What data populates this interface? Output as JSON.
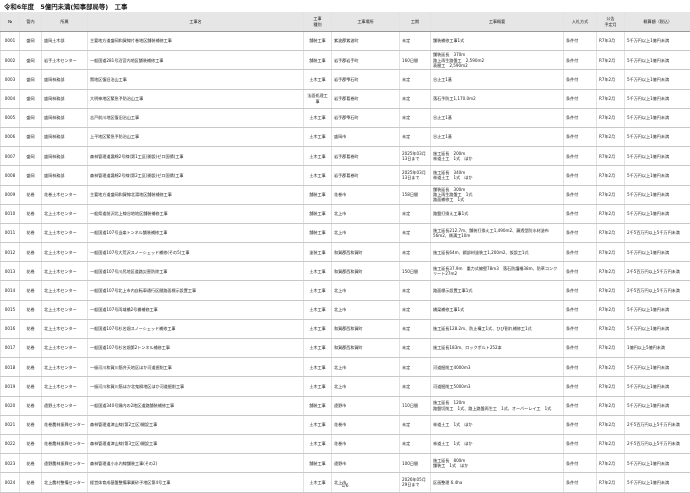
{
  "title": "令和6年度　5億円未満(知事部局等)　工事",
  "page_number": "1/6",
  "columns": [
    "№",
    "管内",
    "所属",
    "工事名",
    "工事\n種別",
    "工事場所",
    "工期",
    "工事概要",
    "入札方式",
    "公告\n予定月",
    "概算額（税込）"
  ],
  "rows": [
    [
      "0001",
      "盛岡",
      "盛岡土木部",
      "主要地方道盛岡和賀線片巻地区舗装補修工事",
      "舗装工事",
      "紫波郡紫波町",
      "未定",
      "舗装補修工事1式",
      "条件付",
      "R7年3月",
      "5千万円以上1億円未満"
    ],
    [
      "0002",
      "盛岡",
      "岩手土木センター",
      "一般国道281号沼宮内地区舗装補修工事",
      "舗装工事",
      "岩手郡岩手町",
      "160日間",
      "舗装延長　370m\n路上再生路盤工　2,590m2\n表層工　2,590m2",
      "条件付",
      "R7年2月",
      "5千万円以上1億円未満"
    ],
    [
      "0003",
      "盛岡",
      "盛岡林務部",
      "賢地区復旧治山工事",
      "土木工事",
      "岩手郡雫石町",
      "未定",
      "谷止工1基",
      "条件付",
      "R7年2月",
      "5千万円以上1億円未満"
    ],
    [
      "0004",
      "盛岡",
      "盛岡林務部",
      "大明神地区緊急予防治山工事",
      "法面処理工事",
      "岩手郡葛巻町",
      "未定",
      "落石予防工1,170.0m2",
      "条件付",
      "R7年2月",
      "5千万円以上1億円未満"
    ],
    [
      "0005",
      "盛岡",
      "盛岡林務部",
      "志戸前川地区復旧治山工事",
      "土木工事",
      "岩手郡雫石町",
      "未定",
      "谷止工1基",
      "条件付",
      "R7年2月",
      "5千万円以上1億円未満"
    ],
    [
      "0006",
      "盛岡",
      "盛岡林務部",
      "上平地区緊急予防治山工事",
      "土木工事",
      "盛岡市",
      "未定",
      "谷止工1基",
      "条件付",
      "R7年2月",
      "5千万円以上1億円未満"
    ],
    [
      "0007",
      "盛岡",
      "盛岡林務部",
      "森林管理道袰綿2号線(第1工区)開設(ゼロ国債)工事",
      "土木工事",
      "岩手郡葛巻町",
      "2025年03月\n13日まで",
      "施工延長　200m\n林道土工　1式　ほか",
      "条件付",
      "R7年2月",
      "5千万円以上1億円未満"
    ],
    [
      "0008",
      "盛岡",
      "盛岡林務部",
      "森林管理道袰綿2号線(第2工区)開設(ゼロ国債)工事",
      "土木工事",
      "岩手郡葛巻町",
      "2025年03月\n13日まで",
      "施工延長　340m\n林道土工　1式　ほか",
      "条件付",
      "R7年2月",
      "5千万円以上1億円未満"
    ],
    [
      "0009",
      "花巻",
      "花巻土木センター",
      "主要地方道盛岡和賀線北湯地区舗装補修工事",
      "舗装工事",
      "花巻市",
      "158日間",
      "舗装延長　300m\n路上再生路盤工　1式\n路面補修工　1式",
      "条件付",
      "R7年2月",
      "5千万円以上1億円未満"
    ],
    [
      "0010",
      "花巻",
      "北上土木センター",
      "一般県道前沢北上線谷地地区舗装補修工事",
      "舗装工事",
      "北上市",
      "未定",
      "路盤打換え工事1式",
      "条件付",
      "R7年2月",
      "5千万円以上1億円未満"
    ],
    [
      "0011",
      "花巻",
      "北上土木センター",
      "一般国道107号当楽トンネル舗装補修工事",
      "舗装工事",
      "北上市",
      "未定",
      "施工延長212.7m、舗装打換え工1,490m2、漏透型防水材塗布56m2、側溝工10m",
      "条件付",
      "R7年2月",
      "2千5百万円以上5千万円未満"
    ],
    [
      "0012",
      "花巻",
      "北上土木センター",
      "一般国道107号大荒沢スノーシェッド補修(その5)工事",
      "塗装工事",
      "和賀郡西和賀町",
      "未定",
      "施工延長64m、鋼部材塗装工1,200m2、仮設工1式",
      "条件付",
      "R7年2月",
      "5千万円以上1億円未満"
    ],
    [
      "0013",
      "花巻",
      "北上土木センター",
      "一般国道107号川尻地区道路災害防除工事",
      "土木工事",
      "和賀郡西和賀町",
      "150日間",
      "施工延長37.9m　重力式擁壁78m3　落石防護柵38m、防草コンクリート27m2",
      "条件付",
      "R7年2月",
      "2千5百万円以上5千万円未満"
    ],
    [
      "0014",
      "花巻",
      "北上土木センター",
      "一般国道107号北上市内自転車通行区間路面標示設置工事",
      "土木工事",
      "北上市",
      "未定",
      "路面標示設置工事1式",
      "条件付",
      "R7年2月",
      "2千5百万円以上5千万円未満"
    ],
    [
      "0015",
      "花巻",
      "北上土木センター",
      "一般国道107号両域橋2号橋補修工事",
      "土木工事",
      "北上市",
      "未定",
      "橋梁補修工事1式",
      "条件付",
      "R7年2月",
      "5千万円以上1億円未満"
    ],
    [
      "0016",
      "花巻",
      "北上土木センター",
      "一般国道107号杉名畑スノーシェッド補修工事",
      "土木工事",
      "和賀郡西和賀町",
      "未定",
      "施工延長128.2m、防止構工1式、ひび割れ補修工1式",
      "条件付",
      "R7年2月",
      "5千万円以上1億円未満"
    ],
    [
      "0017",
      "花巻",
      "北上土木センター",
      "一般国道107号杉名畑第2トンネル補修工事",
      "土木工事",
      "和賀郡西和賀町",
      "未定",
      "施工延長183m、ロックボルト252本",
      "条件付",
      "R7年2月",
      "1億円以上5億円未満"
    ],
    [
      "0018",
      "花巻",
      "北上土木センター",
      "一級河川和賀川筋弁天地区ほか河道掘削工事",
      "土木工事",
      "北上市",
      "未定",
      "河道掘削工4000m3",
      "条件付",
      "R7年2月",
      "5千万円以上1億円未満"
    ],
    [
      "0019",
      "花巻",
      "北上土木センター",
      "一級河川和賀川筋ほか北鬼柳地区ほか河道掘削工事",
      "土木工事",
      "北上市",
      "未定",
      "河道掘削工5000m3",
      "条件付",
      "R7年2月",
      "5千万円以上1億円未満"
    ],
    [
      "0020",
      "花巻",
      "遠野土木センター",
      "一般国道340号鍋内の2地区道路舗装補修工事",
      "舗装工事",
      "遠野市",
      "110日間",
      "施工延長　120m\n路盤切削工　1式、路上路盤再生工　1式、オーバーレイ工　1式",
      "条件付",
      "R7年2月",
      "5千万円以上1億円未満"
    ],
    [
      "0021",
      "花巻",
      "花巻農林振興センター",
      "森林管理道津山線(第2工区)開設工事",
      "土木工事",
      "花巻市",
      "未定",
      "林道土工　1式　ほか",
      "条件付",
      "R7年2月",
      "2千5百万円以上5千万円未満"
    ],
    [
      "0022",
      "花巻",
      "花巻農林振興センター",
      "森林管理道津山線(第3工区)開設工事",
      "土木工事",
      "花巻市",
      "未定",
      "林道土工　1式　ほか",
      "条件付",
      "R7年2月",
      "2千5百万円以上5千万円未満"
    ],
    [
      "0023",
      "花巻",
      "遠野農林振興センター",
      "森林管理道小水内線舗装工事(その2)",
      "舗装工事",
      "遠野市",
      "100日間",
      "施工延長　800m\n舗装工　1式　ほか",
      "条件付",
      "R7年2月",
      "5千万円以上1億円未満"
    ],
    [
      "0024",
      "花巻",
      "北上農村整備センター",
      "経営体育成基盤整備事業砂子地区第4号工事",
      "土木工事",
      "北上市",
      "2026年05月\n29日まで",
      "区画整理 6.4ha",
      "条件付",
      "R7年2月",
      "5千万円以上1億円未満"
    ]
  ]
}
